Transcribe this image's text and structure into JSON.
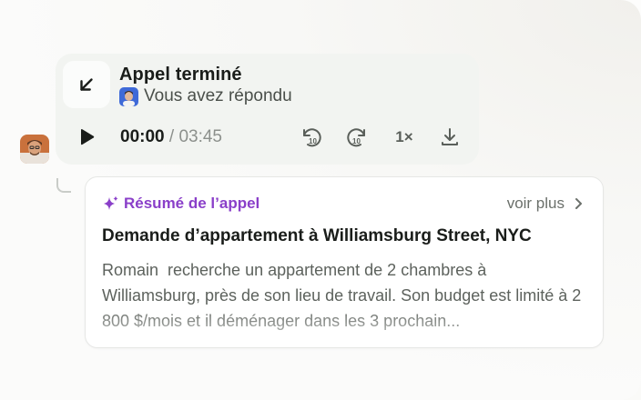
{
  "call": {
    "title": "Appel terminé",
    "status": "Vous avez répondu",
    "current_time": "00:00",
    "separator": " / ",
    "total_time": "03:45",
    "speed": "1×",
    "rewind_seconds": "10",
    "forward_seconds": "10"
  },
  "summary": {
    "label": "Résumé de l’appel",
    "see_more": "voir plus",
    "title": "Demande d’appartement à Williamsburg Street, NYC",
    "body": "Romain  recherche un appartement de 2 chambres à Williamsburg, près de son lieu de travail. Son budget est limité à 2 800 $/mois et il déménager dans les 3 prochain..."
  },
  "colors": {
    "accent": "#8a3fc9",
    "card_bg": "#f2f4f1",
    "text_dark": "#1a1d1a",
    "text_muted": "#5d625d"
  },
  "icons": {
    "call_direction": "arrow-down-left-icon",
    "play": "play-icon",
    "rewind": "rewind-10-icon",
    "forward": "forward-10-icon",
    "download": "download-icon",
    "sparkle": "sparkle-icon",
    "chevron": "chevron-right-icon"
  }
}
